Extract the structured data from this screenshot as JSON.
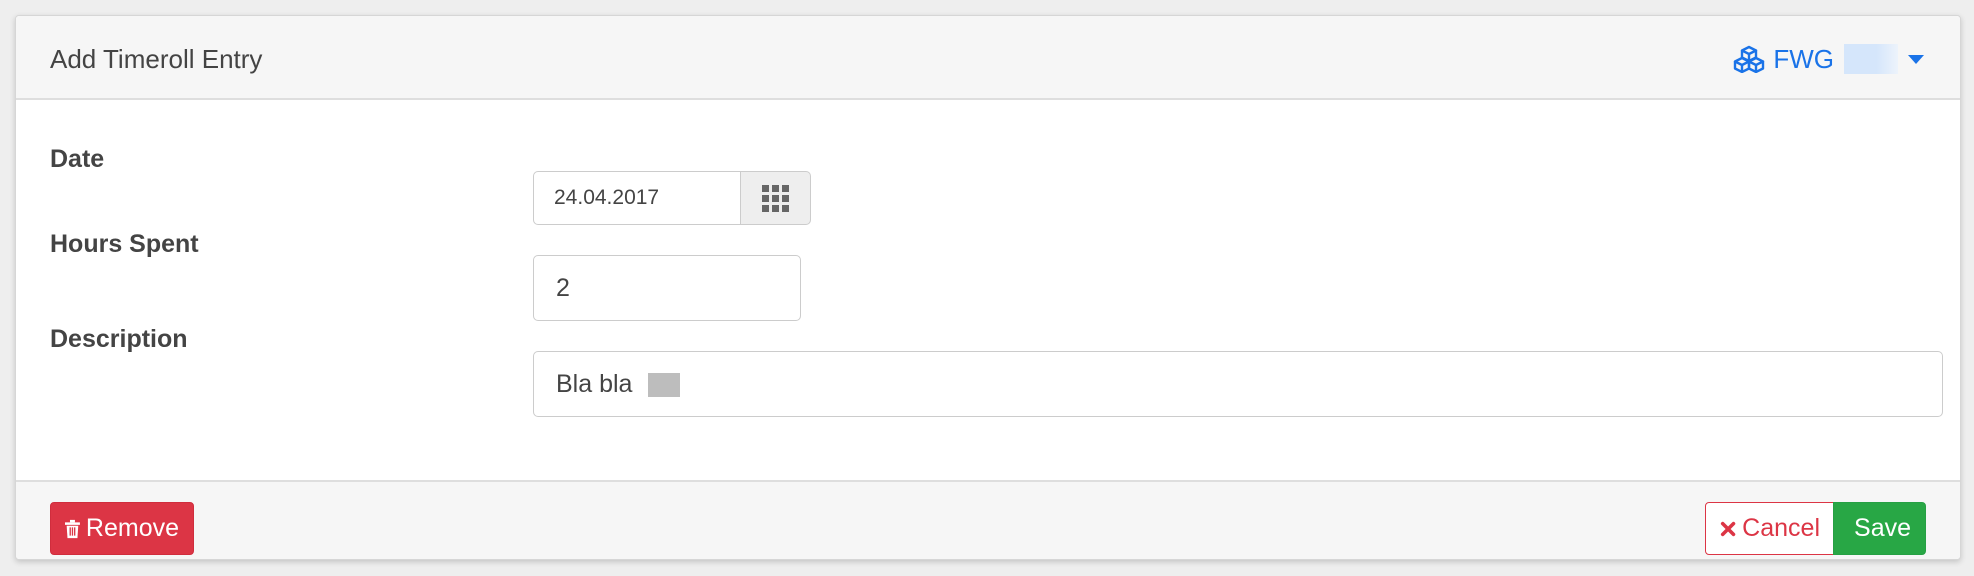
{
  "header": {
    "title": "Add Timeroll Entry",
    "org_label": "FWG",
    "org_icon": "cubes-icon",
    "accent_color": "#1a73e8"
  },
  "form": {
    "date": {
      "label": "Date",
      "value": "24.04.2017",
      "icon": "calendar-grid-icon"
    },
    "hours": {
      "label": "Hours Spent",
      "value": "2"
    },
    "description": {
      "label": "Description",
      "value": "Bla bla"
    }
  },
  "footer": {
    "remove_label": "Remove",
    "cancel_label": "Cancel",
    "save_label": "Save",
    "colors": {
      "danger": "#dc3545",
      "success": "#28a745"
    }
  }
}
